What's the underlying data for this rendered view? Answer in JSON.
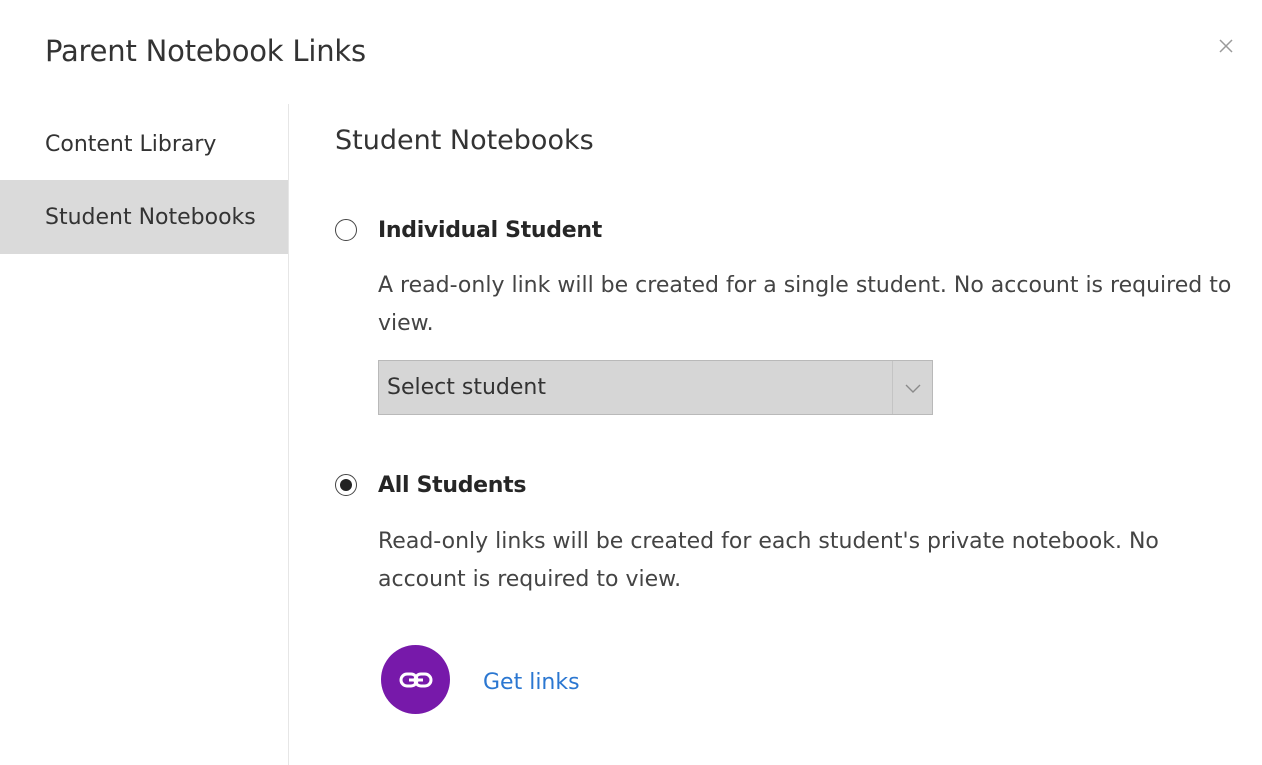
{
  "dialog": {
    "title": "Parent Notebook Links",
    "close_icon": "close-icon"
  },
  "sidebar": {
    "items": [
      {
        "label": "Content Library",
        "selected": false
      },
      {
        "label": "Student Notebooks",
        "selected": true
      }
    ]
  },
  "main": {
    "section_title": "Student Notebooks",
    "options": [
      {
        "label": "Individual Student",
        "selected": false,
        "description": "A read-only link will be created for a single student. No account is required to view."
      },
      {
        "label": "All Students",
        "selected": true,
        "description": "Read-only links will be created for each student's private notebook. No account is required to view."
      }
    ],
    "student_select": {
      "value": "Select student",
      "icon": "chevron-down-icon"
    },
    "get_links": {
      "label": "Get links",
      "icon": "link-icon"
    }
  },
  "colors": {
    "accent_purple": "#7719aa",
    "link_blue": "#2b77d1",
    "sidebar_selected": "#dadada",
    "select_background": "#d6d6d6"
  }
}
